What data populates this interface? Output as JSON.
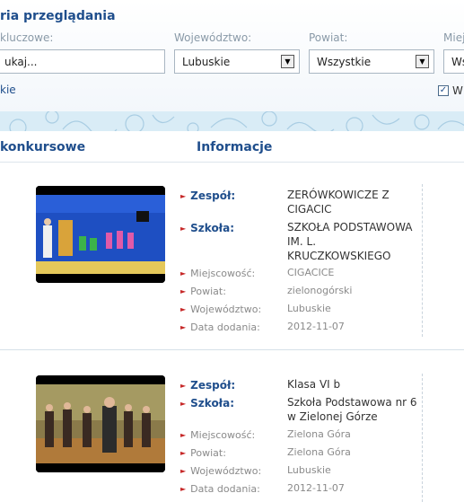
{
  "filters": {
    "title": "ria przeglądania",
    "keywords_label": "kluczowe:",
    "keywords_value": "ukaj...",
    "voivodeship_label": "Województwo:",
    "voivodeship_value": "Lubuskie",
    "county_label": "Powiat:",
    "county_value": "Wszystkie",
    "town_label": "Miej",
    "town_value": "Ws",
    "link_fragment": "kie",
    "checkbox_label": "W",
    "checkbox_checked": true
  },
  "columns": {
    "left": "konkursowe",
    "right": "Informacje"
  },
  "entries": [
    {
      "team_label": "Zespół:",
      "team": "ZERÓWKOWICZE Z CIGACIC",
      "school_label": "Szkoła:",
      "school": "SZKOŁA PODSTAWOWA IM. L. KRUCZKOWSKIEGO",
      "town_label": "Miejscowość:",
      "town": "CIGACICE",
      "county_label": "Powiat:",
      "county": "zielonogórski",
      "voivodeship_label": "Województwo:",
      "voivodeship": "Lubuskie",
      "date_label": "Data dodania:",
      "date": "2012-11-07"
    },
    {
      "team_label": "Zespół:",
      "team": "Klasa VI b",
      "school_label": "Szkoła:",
      "school": "Szkoła Podstawowa nr 6 w Zielonej Górze",
      "town_label": "Miejscowość:",
      "town": "Zielona Góra",
      "county_label": "Powiat:",
      "county": "Zielona Góra",
      "voivodeship_label": "Województwo:",
      "voivodeship": "Lubuskie",
      "date_label": "Data dodania:",
      "date": "2012-11-07"
    }
  ]
}
